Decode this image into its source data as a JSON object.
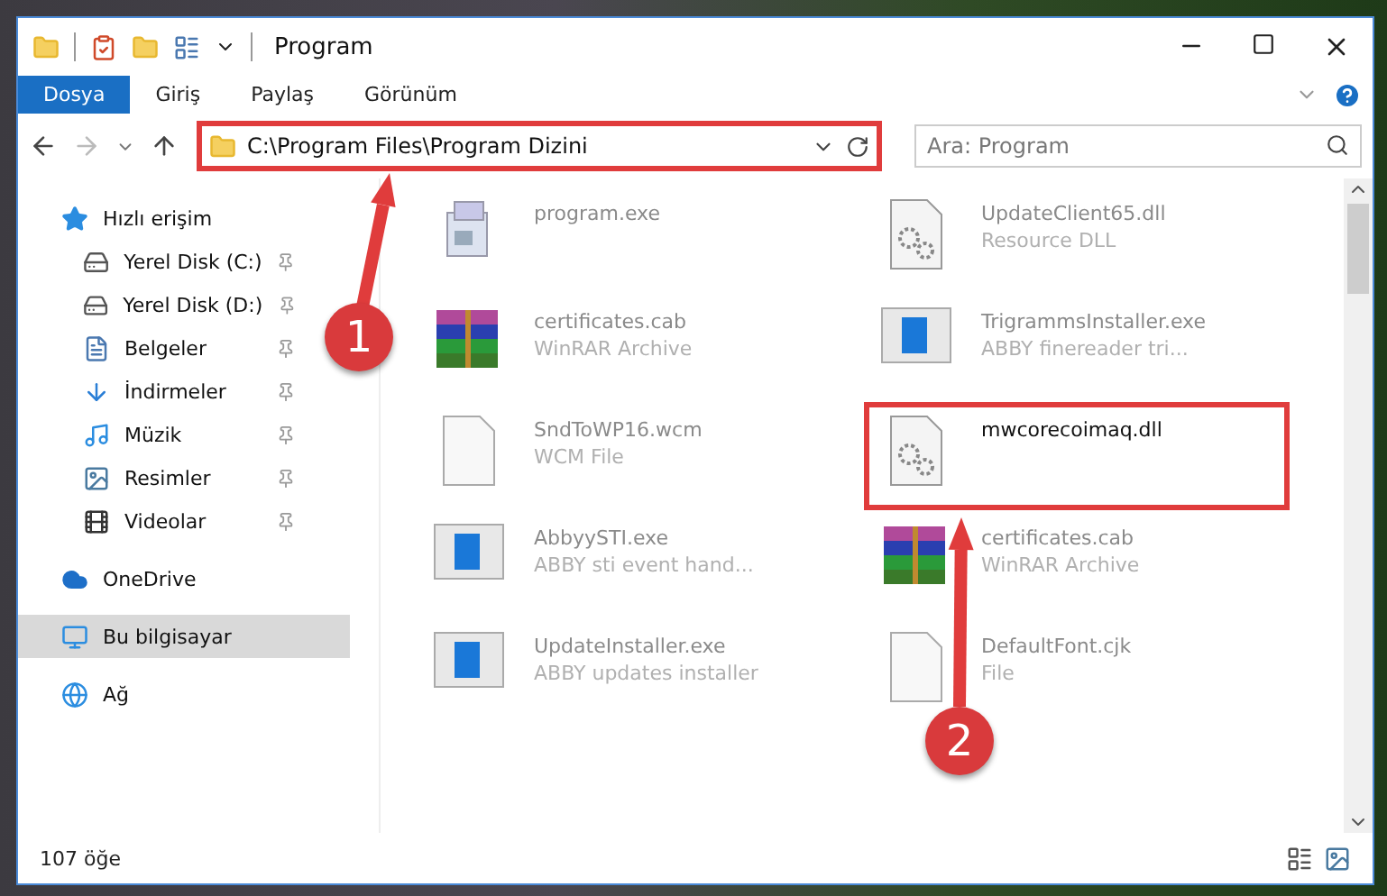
{
  "window": {
    "title": "Program"
  },
  "ribbon_tabs": [
    {
      "label": "Dosya",
      "selected": true
    },
    {
      "label": "Giriş",
      "selected": false
    },
    {
      "label": "Paylaş",
      "selected": false
    },
    {
      "label": "Görünüm",
      "selected": false
    }
  ],
  "address_bar": {
    "value": "C:\\Program Files\\Program Dizini",
    "highlighted": true
  },
  "search": {
    "placeholder": "Ara: Program"
  },
  "sidebar": {
    "items": [
      {
        "kind": "star",
        "label": "Hızlı erişim",
        "selected": false,
        "children": [
          {
            "kind": "disk-c",
            "label": "Yerel Disk (C:)",
            "pinned": true,
            "selected": false
          },
          {
            "kind": "disk",
            "label": "Yerel Disk (D:)",
            "pinned": true,
            "selected": false
          },
          {
            "kind": "document",
            "label": "Belgeler",
            "pinned": true,
            "selected": false
          },
          {
            "kind": "download",
            "label": "İndirmeler",
            "pinned": true,
            "selected": false
          },
          {
            "kind": "music",
            "label": "Müzik",
            "pinned": true,
            "selected": false
          },
          {
            "kind": "pictures",
            "label": "Resimler",
            "pinned": true,
            "selected": false
          },
          {
            "kind": "video",
            "label": "Videolar",
            "pinned": true,
            "selected": false
          }
        ]
      },
      {
        "kind": "cloud",
        "label": "OneDrive",
        "selected": false
      },
      {
        "kind": "computer",
        "label": "Bu bilgisayar",
        "selected": true
      },
      {
        "kind": "network",
        "label": "Ağ",
        "selected": false
      }
    ]
  },
  "files": [
    {
      "kind": "installer",
      "name": "program.exe",
      "highlighted": false
    },
    {
      "kind": "dll",
      "name": "UpdateClient65.dll",
      "type": "Resource DLL",
      "highlighted": false
    },
    {
      "kind": "archive",
      "name": "certificates.cab",
      "type": "WinRAR Archive",
      "highlighted": false
    },
    {
      "kind": "app",
      "name": "TrigrammsInstaller.exe",
      "type": "ABBY finereader tri...",
      "highlighted": false
    },
    {
      "kind": "blank",
      "name": "SndToWP16.wcm",
      "type": "WCM File",
      "highlighted": false
    },
    {
      "kind": "dll",
      "name": "mwcorecoimaq.dll",
      "highlighted": true
    },
    {
      "kind": "app",
      "name": "AbbyySTI.exe",
      "type": "ABBY sti event hand...",
      "highlighted": false
    },
    {
      "kind": "archive",
      "name": "certificates.cab",
      "type": "WinRAR Archive",
      "highlighted": false
    },
    {
      "kind": "app",
      "name": "UpdateInstaller.exe",
      "type": "ABBY updates installer",
      "highlighted": false
    },
    {
      "kind": "blank",
      "name": "DefaultFont.cjk",
      "type": "File",
      "highlighted": false
    }
  ],
  "status_bar": {
    "count": "107 öğe"
  },
  "annotations": [
    {
      "label": "1"
    },
    {
      "label": "2"
    }
  ]
}
